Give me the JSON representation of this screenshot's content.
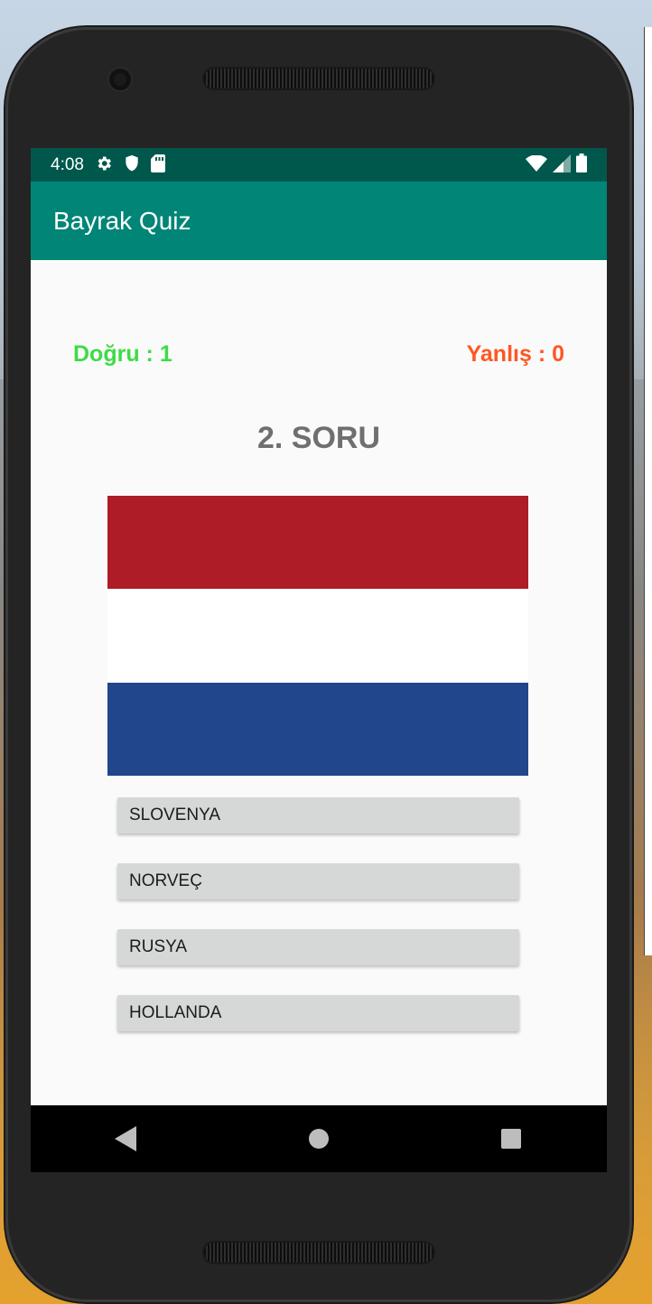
{
  "status_bar": {
    "time": "4:08",
    "icons_left": [
      "gear-icon",
      "shield-icon",
      "sd-card-icon"
    ],
    "icons_right": [
      "wifi-icon",
      "cell-signal-icon",
      "battery-icon"
    ]
  },
  "app_bar": {
    "title": "Bayrak Quiz"
  },
  "score": {
    "correct_label": "Doğru : 1",
    "wrong_label": "Yanlış : 0"
  },
  "question": {
    "label": "2. SORU"
  },
  "flag": {
    "bands": [
      "#ae1c28",
      "#ffffff",
      "#21468b"
    ]
  },
  "answers": [
    {
      "label": "SLOVENYA"
    },
    {
      "label": "NORVEÇ"
    },
    {
      "label": "RUSYA"
    },
    {
      "label": "HOLLANDA"
    }
  ],
  "nav_bar": {
    "buttons": [
      "back-icon",
      "home-icon",
      "recents-icon"
    ]
  },
  "colors": {
    "status_bar": "#00574b",
    "app_bar": "#008577",
    "correct": "#3ddc45",
    "wrong": "#ff5722",
    "question": "#6f6f6f",
    "button": "#d6d7d7"
  }
}
